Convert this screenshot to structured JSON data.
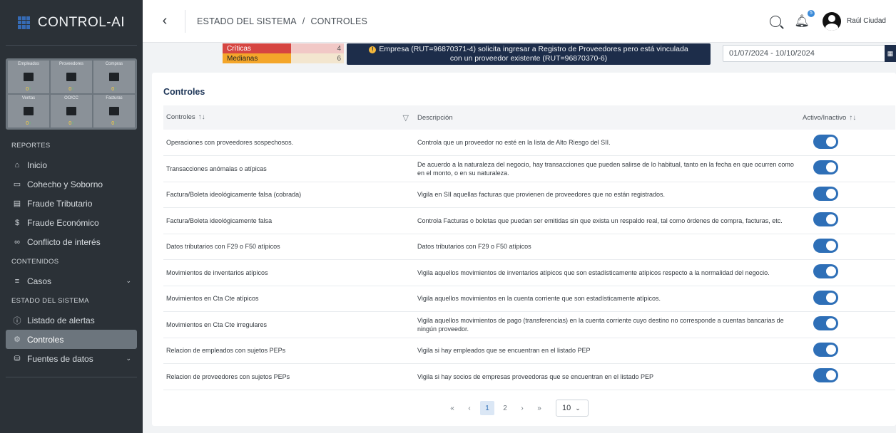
{
  "brand": {
    "name": "CONTROL-AI"
  },
  "stats": [
    {
      "label": "Empleados",
      "icon": "building-icon",
      "count": "0"
    },
    {
      "label": "Proveedores",
      "icon": "store-icon",
      "count": "0"
    },
    {
      "label": "Compras",
      "icon": "cart-icon",
      "count": "0"
    },
    {
      "label": "Ventas",
      "icon": "register-icon",
      "count": "0"
    },
    {
      "label": "OO/CC",
      "icon": "handshake-icon",
      "count": "0"
    },
    {
      "label": "Facturas",
      "icon": "invoice-icon",
      "count": "0"
    }
  ],
  "sidebar": {
    "reportes_label": "REPORTES",
    "reportes": [
      {
        "label": "Inicio",
        "icon": "home-icon"
      },
      {
        "label": "Cohecho y Soborno",
        "icon": "briefcase-icon"
      },
      {
        "label": "Fraude Tributario",
        "icon": "document-icon"
      },
      {
        "label": "Fraude Económico",
        "icon": "dollar-icon"
      },
      {
        "label": "Conflicto de interés",
        "icon": "link-icon"
      }
    ],
    "contenidos_label": "CONTENIDOS",
    "casos_label": "Casos",
    "estado_label": "ESTADO DEL SISTEMA",
    "alertas_label": "Listado de alertas",
    "controles_label": "Controles",
    "fuentes_label": "Fuentes de datos"
  },
  "topbar": {
    "crumb_root": "ESTADO DEL SISTEMA",
    "crumb_sep": "/",
    "crumb_current": "CONTROLES",
    "notif_count": "5",
    "user_name": "Raúl Ciudad"
  },
  "alerts": {
    "critical_label": "Críticas",
    "critical_count": "4",
    "medium_label": "Medianas",
    "medium_count": "6",
    "message_line1": "Empresa (RUT=96870371-4) solicita ingresar a Registro de Proveedores pero está vinculada",
    "message_line2": "con un proveedor existente (RUT=96870370-6)",
    "date_range": "01/07/2024 - 10/10/2024"
  },
  "card": {
    "title": "Controles",
    "col_controles": "Controles",
    "col_descripcion": "Descripción",
    "col_activo": "Activo/Inactivo",
    "rows": [
      {
        "name": "Operaciones con proveedores sospechosos.",
        "desc": "Controla que un proveedor no esté en la lista de Alto Riesgo del SII."
      },
      {
        "name": "Transacciones anómalas o atípicas",
        "desc": "De acuerdo a la naturaleza del negocio, hay transacciones que pueden salirse de lo habitual, tanto en la fecha en que ocurren como en el monto, o en su naturaleza."
      },
      {
        "name": "Factura/Boleta ideológicamente falsa (cobrada)",
        "desc": "Vigila en SII aquellas facturas que provienen de proveedores que no están registrados."
      },
      {
        "name": "Factura/Boleta ideológicamente falsa",
        "desc": "Controla Facturas o boletas que puedan ser emitidas sin que exista un respaldo real, tal como órdenes de compra, facturas, etc."
      },
      {
        "name": "Datos tributarios con F29 o F50 atípicos",
        "desc": "Datos tributarios con F29 o F50 atípicos"
      },
      {
        "name": "Movimientos de inventarios atípicos",
        "desc": "Vigila aquellos movimientos de inventarios atípicos que son estadísticamente atípicos respecto a la normalidad del negocio."
      },
      {
        "name": "Movimientos en Cta Cte atípicos",
        "desc": "Vigila aquellos movimientos en la cuenta corriente que son estadísticamente atípicos."
      },
      {
        "name": "Movimientos en Cta Cte irregulares",
        "desc": "Vigila aquellos movimientos de pago (transferencias) en la cuenta corriente cuyo destino no corresponde a cuentas bancarias de ningún proveedor."
      },
      {
        "name": "Relacion de empleados con sujetos PEPs",
        "desc": "Vigila si hay empleados que se encuentran en el listado PEP"
      },
      {
        "name": "Relacion de proveedores con sujetos PEPs",
        "desc": "Vigila si hay socios de empresas proveedoras que se encuentran en el listado PEP"
      }
    ]
  },
  "pager": {
    "first": "«",
    "prev": "‹",
    "page1": "1",
    "page2": "2",
    "next": "›",
    "last": "»",
    "per_page": "10"
  }
}
